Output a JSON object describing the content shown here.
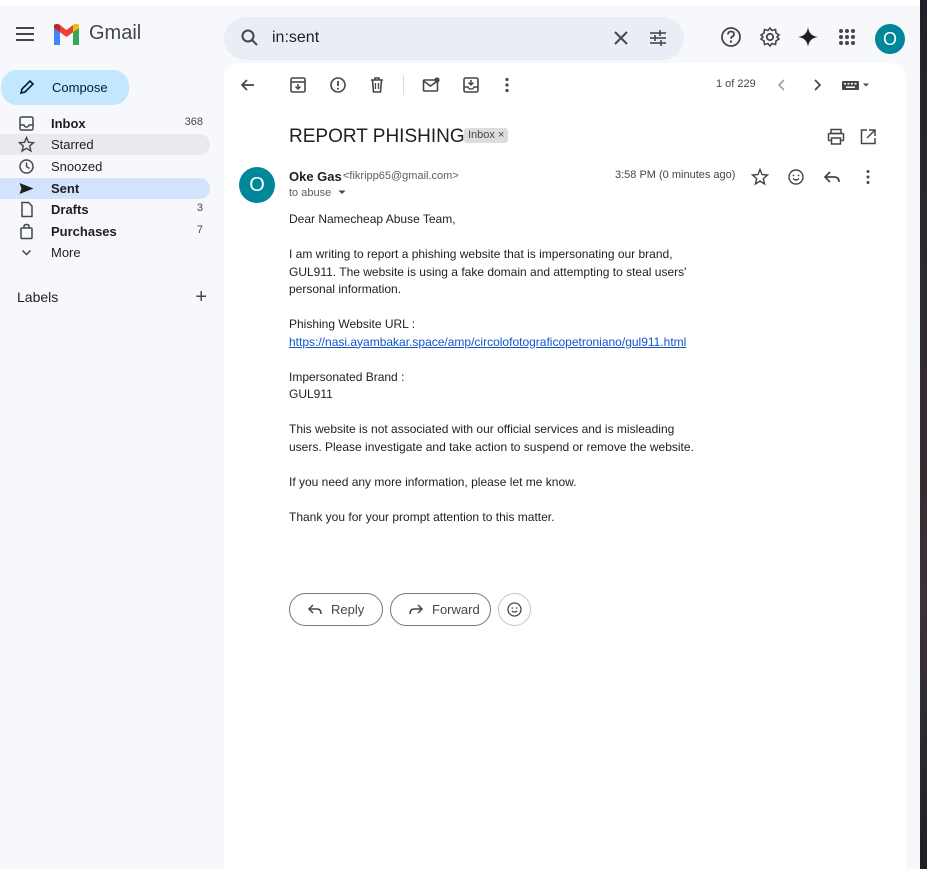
{
  "app": {
    "name": "Gmail",
    "brand_colors": {
      "red": "#ea4335",
      "blue": "#4285f4",
      "green": "#34a853",
      "yellow": "#fbbc04"
    }
  },
  "header": {
    "menu_icon": "hamburger-menu-icon",
    "search": {
      "value": "in:sent",
      "icons": [
        "search-icon",
        "clear-icon",
        "search-options-icon"
      ]
    },
    "right_icons": [
      "help-icon",
      "settings-icon",
      "gemini-icon",
      "apps-grid-icon"
    ],
    "avatar_letter": "O",
    "accent_color": "#00879a"
  },
  "sidebar": {
    "compose_label": "Compose",
    "items": [
      {
        "label": "Inbox",
        "count": "368",
        "icon": "inbox-icon"
      },
      {
        "label": "Starred",
        "count": "",
        "icon": "star-icon"
      },
      {
        "label": "Snoozed",
        "count": "",
        "icon": "clock-icon"
      },
      {
        "label": "Sent",
        "count": "",
        "icon": "send-icon"
      },
      {
        "label": "Drafts",
        "count": "3",
        "icon": "draft-icon"
      },
      {
        "label": "Purchases",
        "count": "7",
        "icon": "purchases-icon"
      },
      {
        "label": "More",
        "count": "",
        "icon": "chevron-down-icon"
      }
    ],
    "labels_heading": "Labels"
  },
  "toolbar": {
    "icons": [
      "back-icon",
      "archive-icon",
      "report-spam-icon",
      "delete-icon",
      "mark-unread-icon",
      "move-to-icon",
      "more-vert-icon"
    ],
    "pager": "1 of 229"
  },
  "message": {
    "subject": "REPORT PHISHING",
    "label_chip": "Inbox",
    "label_chip_close": "×",
    "sender_initial": "O",
    "sender_name": "Oke Gas",
    "sender_email": "<fikripp65@gmail.com>",
    "to_line": "to abuse",
    "time": "3:58 PM (0 minutes ago)",
    "body": [
      "Dear Namecheap Abuse Team,",
      "I am writing to report a phishing website that is impersonating our brand, GUL911. The website is using a fake domain and attempting to steal users' personal information.",
      "Phishing Website URL :",
      "https://nasi.ayambakar.space/amp/circolofotograficopetroniano/gul911.html",
      "Impersonated Brand :",
      "GUL911",
      "This website is not associated with our official services and is misleading users. Please investigate and take action to suspend or remove the website.",
      "If you need any more information, please let me know.",
      "Thank you for your prompt attention to this matter."
    ],
    "actions": {
      "reply": "Reply",
      "forward": "Forward"
    }
  }
}
